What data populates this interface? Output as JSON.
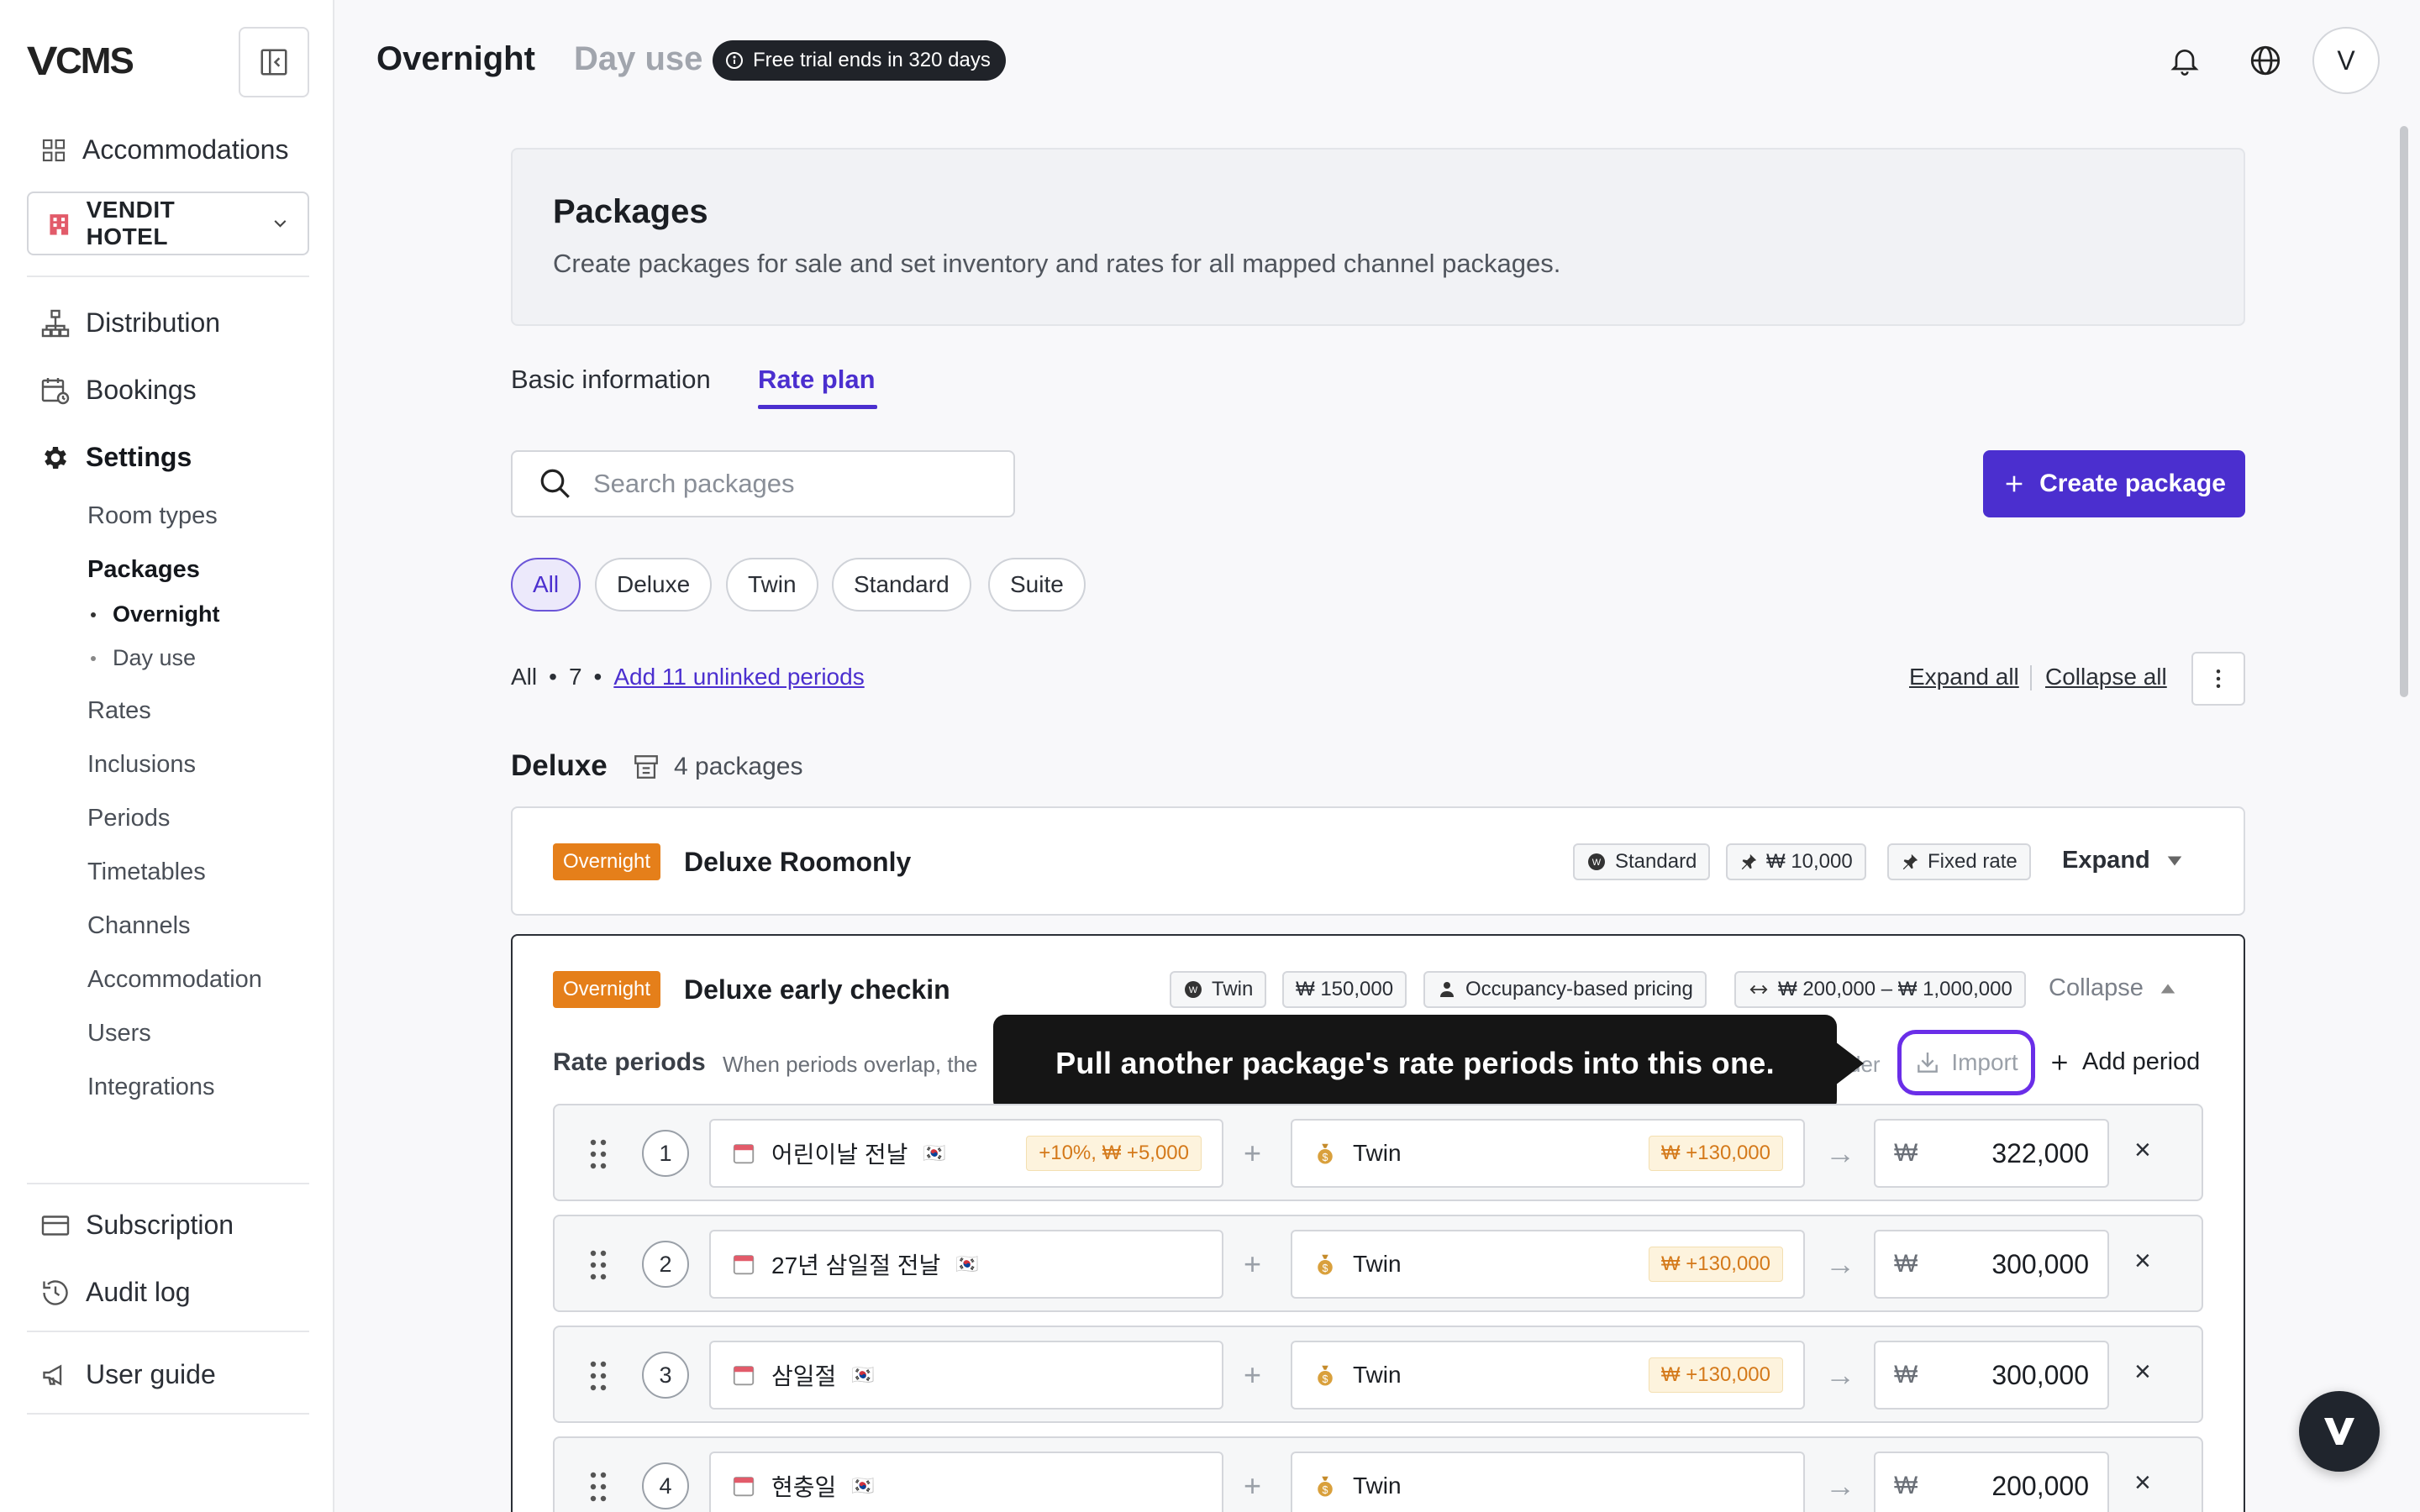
{
  "app": {
    "logo_v": "V",
    "logo_text": "CMS"
  },
  "sidebar": {
    "accommodations": "Accommodations",
    "hotel": "VENDIT HOTEL",
    "distribution": "Distribution",
    "bookings": "Bookings",
    "settings": "Settings",
    "settings_items": {
      "room_types": "Room types",
      "packages": "Packages",
      "overnight": "Overnight",
      "day_use": "Day use",
      "rates": "Rates",
      "inclusions": "Inclusions",
      "periods": "Periods",
      "timetables": "Timetables",
      "channels": "Channels",
      "accommodation": "Accommodation",
      "users": "Users",
      "integrations": "Integrations"
    },
    "subscription": "Subscription",
    "audit_log": "Audit log",
    "user_guide": "User guide"
  },
  "topbar": {
    "title": "Overnight",
    "day_use": "Day use",
    "trial": "Free trial ends in 320 days",
    "avatar": "V"
  },
  "header": {
    "title": "Packages",
    "description": "Create packages for sale and set inventory and rates for all mapped channel packages."
  },
  "tabs": {
    "basic": "Basic information",
    "rate_plan": "Rate plan"
  },
  "search": {
    "placeholder": "Search packages"
  },
  "create_button": "Create package",
  "filters": [
    "All",
    "Deluxe",
    "Twin",
    "Standard",
    "Suite"
  ],
  "summary": {
    "all": "All",
    "bullet": "•",
    "count": "7",
    "add_unlinked": "Add 11 unlinked periods",
    "expand_all": "Expand all",
    "collapse_all": "Collapse all"
  },
  "group": {
    "title": "Deluxe",
    "count": "4 packages"
  },
  "packages": [
    {
      "tag": "Overnight",
      "name": "Deluxe Roomonly",
      "pills": [
        "Standard",
        "₩ 10,000",
        "Fixed rate"
      ],
      "toggle": "Expand"
    },
    {
      "tag": "Overnight",
      "name": "Deluxe early checkin",
      "pills": [
        "Twin",
        "₩ 150,000",
        "Occupancy-based pricing",
        "₩ 200,000 – ₩ 1,000,000"
      ],
      "toggle": "Collapse"
    }
  ],
  "rate_periods": {
    "title": "Rate periods",
    "help": "When periods overlap, the",
    "help_tail": "der",
    "import": "Import",
    "add_period": "Add period",
    "tooltip": "Pull another package's rate periods into this one.",
    "rows": [
      {
        "num": "1",
        "period": "어린이날 전날",
        "period_badge": "+10%, ₩ +5,000",
        "room": "Twin",
        "room_badge": "₩ +130,000",
        "currency": "₩",
        "price": "322,000"
      },
      {
        "num": "2",
        "period": "27년 삼일절 전날",
        "period_badge": "",
        "room": "Twin",
        "room_badge": "₩ +130,000",
        "currency": "₩",
        "price": "300,000"
      },
      {
        "num": "3",
        "period": "삼일절",
        "period_badge": "",
        "room": "Twin",
        "room_badge": "₩ +130,000",
        "currency": "₩",
        "price": "300,000"
      },
      {
        "num": "4",
        "period": "현충일",
        "period_badge": "",
        "room": "Twin",
        "room_badge": "",
        "currency": "₩",
        "price": "200,000"
      }
    ]
  },
  "glyphs": {
    "plus": "+",
    "arrow": "→",
    "close": "×",
    "kr_flag": "🇰🇷"
  },
  "colors": {
    "accent": "#4b2fcf",
    "overnight_tag": "#e57f1a",
    "import_highlight": "#6a2ee8"
  }
}
